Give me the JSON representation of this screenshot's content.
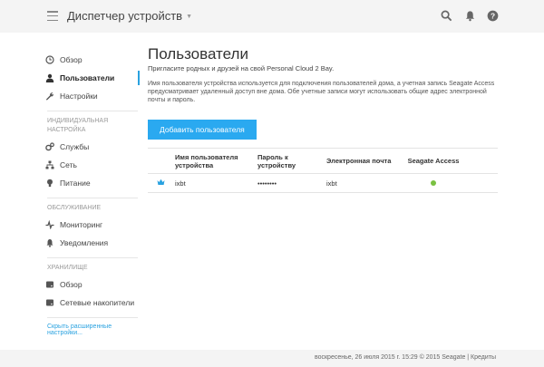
{
  "header": {
    "title": "Диспетчер устройств",
    "icons": [
      "search-icon",
      "bell-icon",
      "help-icon"
    ]
  },
  "sidebar": {
    "items_main": [
      {
        "label": "Обзор",
        "icon": "clock-icon"
      },
      {
        "label": "Пользователи",
        "icon": "user-icon",
        "active": true
      },
      {
        "label": "Настройки",
        "icon": "wrench-icon"
      }
    ],
    "section_personal": "ИНДИВИДУАЛЬНАЯ НАСТРОЙКА",
    "items_personal": [
      {
        "label": "Службы",
        "icon": "gears-icon"
      },
      {
        "label": "Сеть",
        "icon": "network-icon"
      },
      {
        "label": "Питание",
        "icon": "bulb-icon"
      }
    ],
    "section_service": "ОБСЛУЖИВАНИЕ",
    "items_service": [
      {
        "label": "Мониторинг",
        "icon": "pulse-icon"
      },
      {
        "label": "Уведомления",
        "icon": "bell-icon"
      }
    ],
    "section_storage": "ХРАНИЛИЩЕ",
    "items_storage": [
      {
        "label": "Обзор",
        "icon": "disk-icon"
      },
      {
        "label": "Сетевые накопители",
        "icon": "disk-icon"
      }
    ],
    "advanced_link": "Скрыть расширенные настройки..."
  },
  "main": {
    "title": "Пользователи",
    "subtitle": "Пригласите родных и друзей на свой Personal Cloud 2 Bay.",
    "description": "Имя пользователя устройства используется для подключения пользователей дома, а учетная запись Seagate Access предусматривает удаленный доступ вне дома. Обе учетные записи могут использовать общие адрес электронной почты и пароль.",
    "add_button": "Добавить пользователя",
    "table": {
      "headers": {
        "username": "Имя пользователя устройства",
        "password": "Пароль к устройству",
        "email": "Электронная почта",
        "access": "Seagate Access"
      },
      "rows": [
        {
          "username": "ixbt",
          "password": "••••••••",
          "email": "ixbt",
          "access_status": "enabled",
          "admin": true
        }
      ]
    }
  },
  "footer": {
    "text": "воскресенье, 26 июля 2015 г.   15:29   © 2015 Seagate | Кредиты"
  },
  "colors": {
    "accent": "#2aa2e0",
    "button": "#2aa9f0",
    "status_on": "#7ac142"
  }
}
